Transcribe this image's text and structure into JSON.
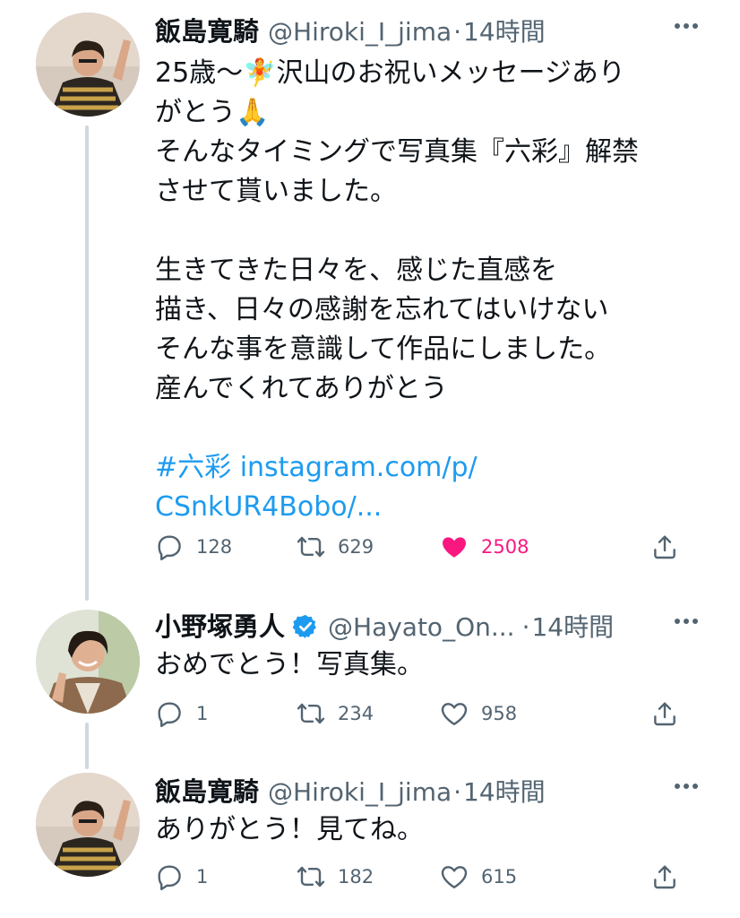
{
  "tweets": [
    {
      "author": {
        "name": "飯島寛騎",
        "handle": "@Hiroki_I_jima",
        "verified": false
      },
      "separator": "·",
      "time": "14時間",
      "text": "25歳〜🧚沢山のお祝いメッセージありがとう🙏\nそんなタイミングで写真集『六彩』解禁させて貰いました。\n\n生きてきた日々を、感じた直感を\n描き、日々の感謝を忘れてはいけない\nそんな事を意識して作品にしました。\n産んでくれてありがとう",
      "text_lines": [
        "25歳〜🧚沢山のお祝いメッセージあり",
        "がとう🙏",
        "そんなタイミングで写真集『六彩』解禁",
        "させて貰いました。",
        "",
        "生きてきた日々を、感じた直感を",
        "描き、日々の感謝を忘れてはいけない",
        "そんな事を意識して作品にしました。",
        "産んでくれてありがとう"
      ],
      "hashtag": "#六彩",
      "link_line1": "instagram.com/p/",
      "link_line2": "CSnkUR4Bobo/...",
      "reply_count": "128",
      "retweet_count": "629",
      "like_count": "2508",
      "liked": true
    },
    {
      "author": {
        "name": "小野塚勇人",
        "handle": "@Hayato_On...",
        "verified": true
      },
      "separator": "·",
      "time": "14時間",
      "text": "おめでとう！写真集。",
      "reply_count": "1",
      "retweet_count": "234",
      "like_count": "958",
      "liked": false
    },
    {
      "author": {
        "name": "飯島寛騎",
        "handle": "@Hiroki_I_jima",
        "verified": false
      },
      "separator": "·",
      "time": "14時間",
      "text": "ありがとう！見てね。",
      "reply_count": "1",
      "retweet_count": "182",
      "like_count": "615",
      "liked": false
    }
  ],
  "icons": {
    "reply": "reply-icon",
    "retweet": "retweet-icon",
    "like": "heart-icon",
    "share": "share-icon",
    "more": "more-icon",
    "verified": "verified-badge-icon"
  },
  "colors": {
    "text": "#0f1419",
    "secondary": "#536471",
    "link": "#1d9bf0",
    "like": "#f91880",
    "thread_line": "#cfd9de"
  }
}
